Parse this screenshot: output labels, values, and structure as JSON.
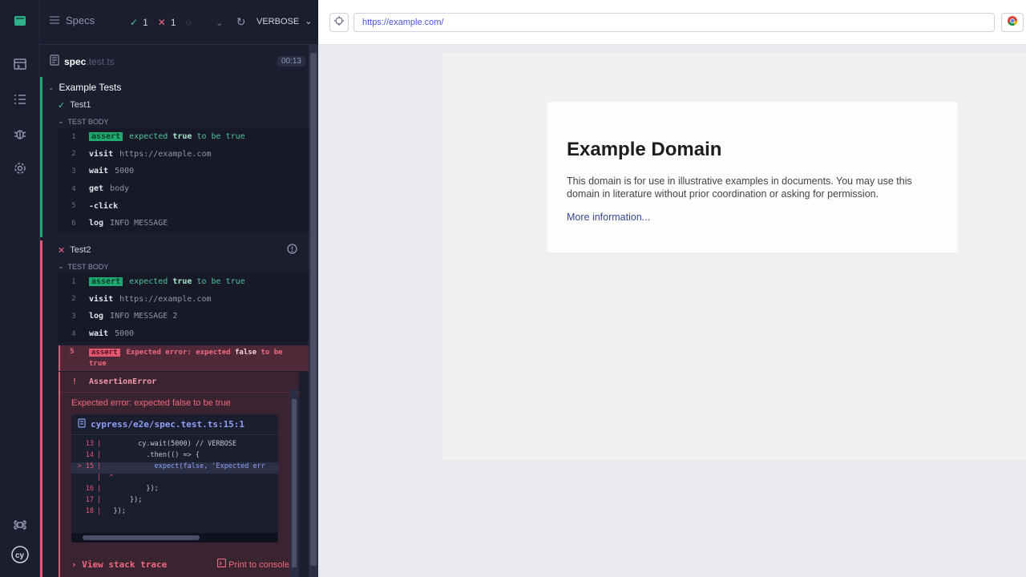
{
  "reporter": {
    "specs_label": "Specs",
    "stats": {
      "passed": "1",
      "failed": "1",
      "pending": ""
    },
    "verbose_label": "VERBOSE",
    "spec_file": {
      "name": "spec",
      "ext": ".test.ts",
      "duration": "00:13"
    },
    "suite": {
      "title": "Example Tests"
    },
    "tests": [
      {
        "title": "Test1",
        "state": "passed",
        "body_label": "TEST BODY",
        "commands": [
          {
            "num": "1",
            "name": "assert",
            "msg": [
              "expected",
              "true",
              "to be true"
            ]
          },
          {
            "num": "2",
            "name": "visit",
            "msg": "https://example.com"
          },
          {
            "num": "3",
            "name": "wait",
            "msg": "5000"
          },
          {
            "num": "4",
            "name": "get",
            "msg": "body"
          },
          {
            "num": "5",
            "name": "-click",
            "msg": ""
          },
          {
            "num": "6",
            "name": "log",
            "msg": "INFO MESSAGE"
          }
        ]
      },
      {
        "title": "Test2",
        "state": "failed",
        "body_label": "TEST BODY",
        "commands": [
          {
            "num": "1",
            "name": "assert",
            "msg": [
              "expected",
              "true",
              "to be true"
            ]
          },
          {
            "num": "2",
            "name": "visit",
            "msg": "https://example.com"
          },
          {
            "num": "3",
            "name": "log",
            "msg": "INFO MESSAGE 2"
          },
          {
            "num": "4",
            "name": "wait",
            "msg": "5000"
          },
          {
            "num": "5",
            "name": "assert",
            "msg": [
              "Expected error: expected",
              "false",
              "to be",
              "true"
            ]
          }
        ],
        "error": {
          "type": "AssertionError",
          "message": "Expected error: expected false to be true",
          "file": "cypress/e2e/spec.test.ts:15:1",
          "code": [
            {
              "ln": "13",
              "text": "        cy.wait(5000) // VERBOSE"
            },
            {
              "ln": "14",
              "text": "          .then(() => {"
            },
            {
              "ln": "> 15",
              "text": "            expect(false, 'Expected err"
            },
            {
              "ln": "",
              "text": "  ^"
            },
            {
              "ln": "16",
              "text": "          });"
            },
            {
              "ln": "17",
              "text": "      });"
            },
            {
              "ln": "18",
              "text": "  });"
            }
          ],
          "stack_label": "View stack trace",
          "print_label": "Print to console"
        }
      }
    ]
  },
  "aut": {
    "url": "https://example.com/",
    "page": {
      "heading": "Example Domain",
      "paragraph": "This domain is for use in illustrative examples in documents. You may use this domain in literature without prior coordination or asking for permission.",
      "link": "More information..."
    }
  }
}
